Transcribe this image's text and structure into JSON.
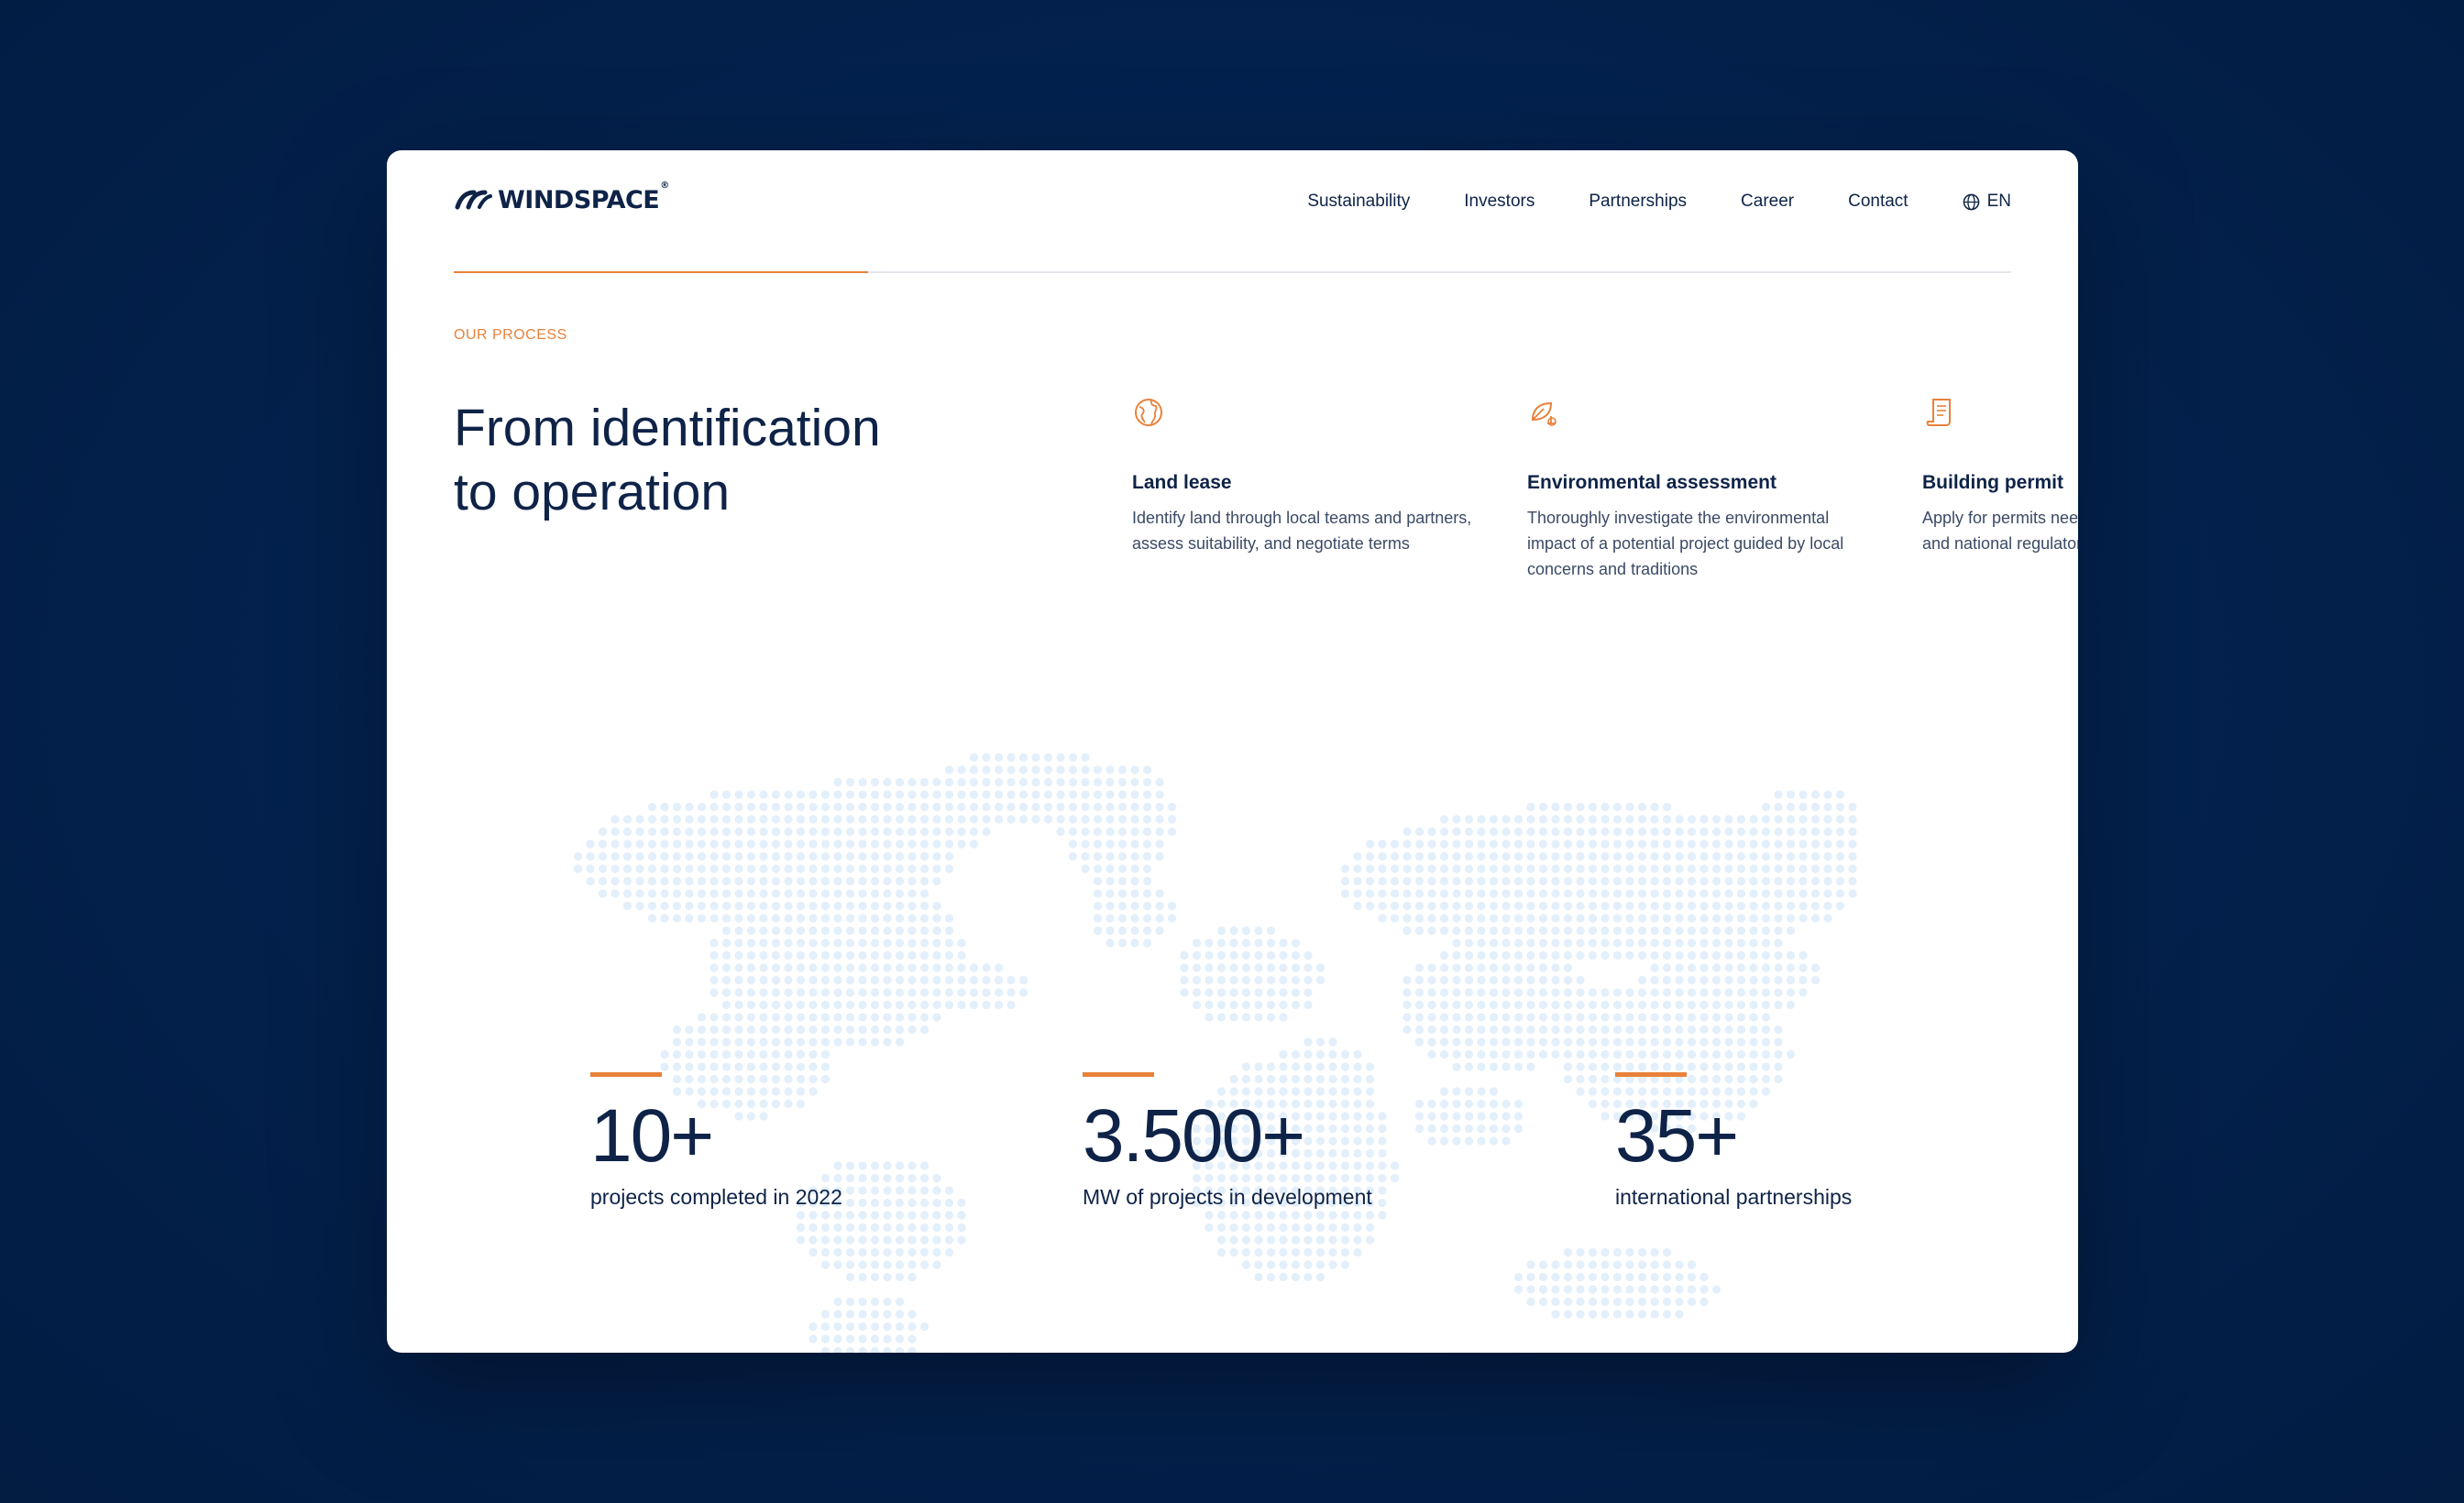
{
  "brand": {
    "name": "WINDSPACE",
    "reg_mark": "®"
  },
  "nav": {
    "items": [
      "Sustainability",
      "Investors",
      "Partnerships",
      "Career",
      "Contact"
    ],
    "language": "EN"
  },
  "process": {
    "eyebrow": "OUR PROCESS",
    "headline_line1": "From identification",
    "headline_line2": "to operation",
    "progress": 0.266,
    "steps": [
      {
        "icon": "globe-icon",
        "title": "Land lease",
        "description": "Identify land through local teams and partners, assess suitability, and negotiate terms"
      },
      {
        "icon": "leaf-icon",
        "title": "Environmental assessment",
        "description": "Thoroughly investigate the environmental impact of a potential project guided by local concerns and traditions"
      },
      {
        "icon": "document-icon",
        "title": "Building permit",
        "description": "Apply for permits needed from local, regional and national regulators"
      }
    ]
  },
  "stats": [
    {
      "value": "10+",
      "label": "projects completed in 2022"
    },
    {
      "value": "3.500+",
      "label": "MW of projects in development"
    },
    {
      "value": "35+",
      "label": "international partnerships"
    }
  ],
  "colors": {
    "accent": "#e8823a",
    "navy": "#0e2347",
    "background": "#03224f",
    "map_dot": "#e3effa"
  }
}
